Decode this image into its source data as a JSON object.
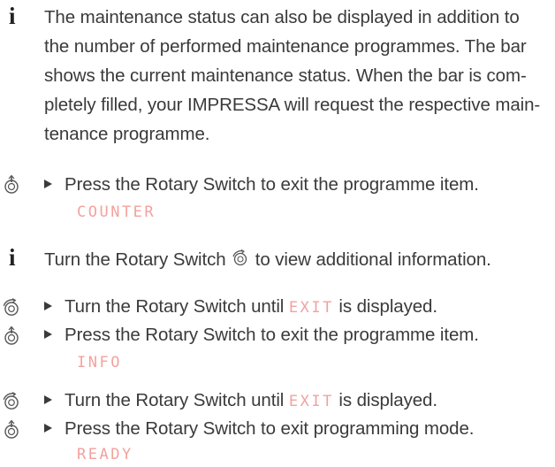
{
  "info_paragraph": [
    "The maintenance status can also be displayed in addition to",
    "the number of performed maintenance programmes. The bar",
    "shows the current maintenance status. When the bar is com-",
    "pletely filled, your IMPRESSA will request the respective main-",
    "tenance programme."
  ],
  "info_icon": "i",
  "steps": {
    "s1": "Press the Rotary Switch to exit the programme item.",
    "d1": "COUNTER",
    "tip": "Turn the Rotary Switch",
    "tip_end": "to view additional information.",
    "s2_pre": "Turn the Rotary Switch until",
    "s2_code": "EXIT",
    "s2_post": "is displayed.",
    "s3": "Press the Rotary Switch to exit the programme item.",
    "d3": "INFO",
    "s4_pre": "Turn the Rotary Switch until",
    "s4_code": "EXIT",
    "s4_post": "is displayed.",
    "s5": "Press the Rotary Switch to exit programming mode.",
    "d5": "READY"
  },
  "icons": [
    "info-icon",
    "press-rotary-icon",
    "turn-rotary-icon"
  ],
  "colors": {
    "display_text": "#f0928d",
    "body_text": "#3a3a3a"
  }
}
